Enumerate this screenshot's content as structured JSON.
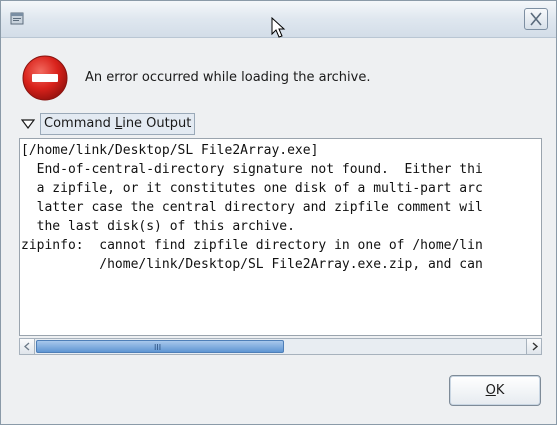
{
  "window": {
    "title": "",
    "close_icon": "close-icon"
  },
  "dialog": {
    "icon": "error-icon",
    "message": "An error occurred while loading the archive."
  },
  "expander": {
    "label_pre": "Command ",
    "label_mnemonic": "L",
    "label_post": "ine Output",
    "expanded": true
  },
  "output": {
    "lines": [
      "[/home/link/Desktop/SL File2Array.exe]",
      "  End-of-central-directory signature not found.  Either thi",
      "  a zipfile, or it constitutes one disk of a multi-part arc",
      "  latter case the central directory and zipfile comment wil",
      "  the last disk(s) of this archive.",
      "zipinfo:  cannot find zipfile directory in one of /home/lin",
      "          /home/link/Desktop/SL File2Array.exe.zip, and can"
    ]
  },
  "scrollbar": {
    "grip": "III",
    "position": 0.0
  },
  "buttons": {
    "ok_mnemonic": "O",
    "ok_rest": "K"
  },
  "colors": {
    "error_red": "#d9221b",
    "thumb_blue": "#5f96d3"
  }
}
